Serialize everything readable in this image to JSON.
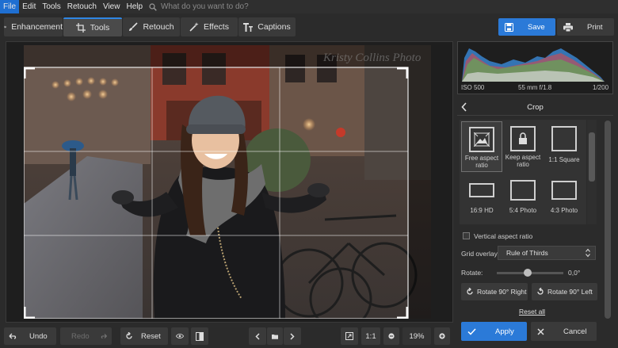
{
  "menu": {
    "items": [
      "File",
      "Edit",
      "Tools",
      "Retouch",
      "View",
      "Help"
    ],
    "search_placeholder": "What do you want to do?"
  },
  "toolbar": {
    "tabs": [
      "Enhancement",
      "Tools",
      "Retouch",
      "Effects",
      "Captions"
    ],
    "active_tab": "Tools",
    "save_label": "Save",
    "print_label": "Print"
  },
  "photo": {
    "watermark": "Kristy Collins Photo"
  },
  "histogram": {
    "iso": "ISO 500",
    "lens": "55 mm f/1.8",
    "shutter": "1/200"
  },
  "panel": {
    "title": "Crop",
    "ratios": [
      {
        "label": "Free aspect ratio",
        "selected": true
      },
      {
        "label": "Keep aspect ratio",
        "selected": false
      },
      {
        "label": "1:1 Square",
        "selected": false
      },
      {
        "label": "16:9 HD",
        "selected": false
      },
      {
        "label": "5:4 Photo",
        "selected": false
      },
      {
        "label": "4:3 Photo",
        "selected": false
      }
    ],
    "vertical_label": "Vertical aspect ratio",
    "grid_label": "Grid overlay:",
    "grid_value": "Rule of Thirds",
    "rotate_label": "Rotate:",
    "rotate_value": "0,0°",
    "rotate_right": "Rotate 90° Right",
    "rotate_left": "Rotate 90° Left",
    "reset_all": "Reset all",
    "apply": "Apply",
    "cancel": "Cancel"
  },
  "bottombar": {
    "undo": "Undo",
    "redo": "Redo",
    "reset": "Reset",
    "ratio": "1:1",
    "zoom": "19%"
  },
  "colors": {
    "accent": "#2b7ad8",
    "background": "#2b2b2b",
    "panel": "#3a3a3a"
  }
}
